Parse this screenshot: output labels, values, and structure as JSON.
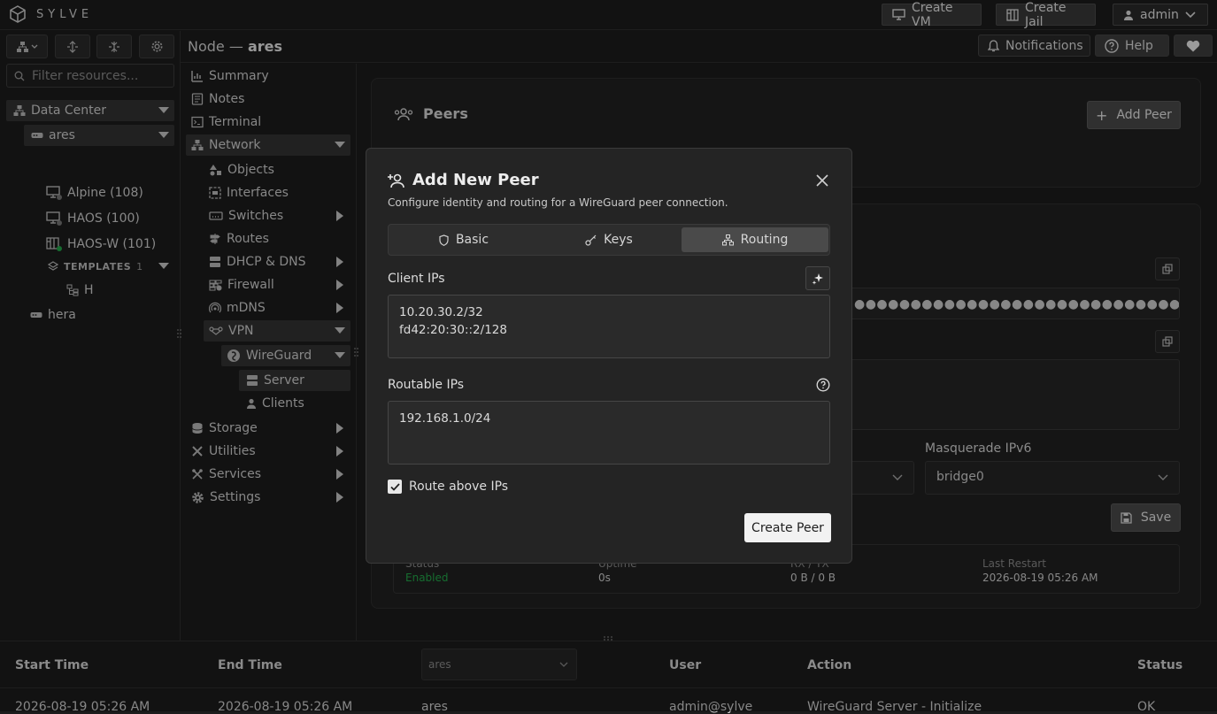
{
  "app": {
    "brand": "SYLVE"
  },
  "topbar": {
    "create_vm": "Create VM",
    "create_jail": "Create Jail",
    "user": "admin"
  },
  "sidebar": {
    "filter_placeholder": "Filter resources...",
    "tree": {
      "datacenter": "Data Center",
      "node_ares": "ares",
      "vm_alpine": "Alpine (108)",
      "vm_haos": "HAOS (100)",
      "jail_haosw": "HAOS-W (101)",
      "templates": "TEMPLATES",
      "templates_count": "1",
      "template_h": "H",
      "node_hera": "hera"
    }
  },
  "header": {
    "prefix": "Node — ",
    "node": "ares",
    "notifications": "Notifications",
    "help": "Help"
  },
  "menu": {
    "summary": "Summary",
    "notes": "Notes",
    "terminal": "Terminal",
    "network": "Network",
    "objects": "Objects",
    "interfaces": "Interfaces",
    "switches": "Switches",
    "routes": "Routes",
    "dhcp": "DHCP & DNS",
    "firewall": "Firewall",
    "mdns": "mDNS",
    "vpn": "VPN",
    "wireguard": "WireGuard",
    "server": "Server",
    "clients": "Clients",
    "storage": "Storage",
    "utilities": "Utilities",
    "services": "Services",
    "settings": "Settings"
  },
  "peers": {
    "title": "Peers",
    "add_peer": "Add Peer"
  },
  "server": {
    "masquerade_ipv6_label": "Masquerade IPv6",
    "masquerade_ipv6_value": "bridge0",
    "save": "Save",
    "status_label": "Status",
    "status_value": "Enabled",
    "uptime_label": "Uptime",
    "uptime_value": "0s",
    "rxtx_label": "RX / TX",
    "rxtx_value": "0 B / 0 B",
    "last_restart_label": "Last Restart",
    "last_restart_value": "2026-08-19 05:26 AM"
  },
  "modal": {
    "title": "Add New Peer",
    "subtitle": "Configure identity and routing for a WireGuard peer connection.",
    "tabs": [
      "Basic",
      "Keys",
      "Routing"
    ],
    "client_ips_label": "Client IPs",
    "client_ips": [
      "10.20.30.2/32",
      "fd42:20:30::2/128"
    ],
    "routable_ips_label": "Routable IPs",
    "routable_ips": [
      "192.168.1.0/24"
    ],
    "route_checkbox_label": "Route above IPs",
    "route_checked": true,
    "create_button": "Create Peer"
  },
  "tasks": {
    "headers": [
      "Start Time",
      "End Time",
      "User",
      "Action",
      "Status"
    ],
    "node_filter": "ares",
    "row": {
      "start": "2026-08-19 05:26 AM",
      "end": "2026-08-19 05:26 AM",
      "node": "ares",
      "user": "admin@sylve",
      "action": "WireGuard Server - Initialize",
      "status": "OK"
    }
  },
  "colors": {
    "accent_green": "#22a84a",
    "bg": "#1c1c1c",
    "modal_bg": "#242424"
  }
}
